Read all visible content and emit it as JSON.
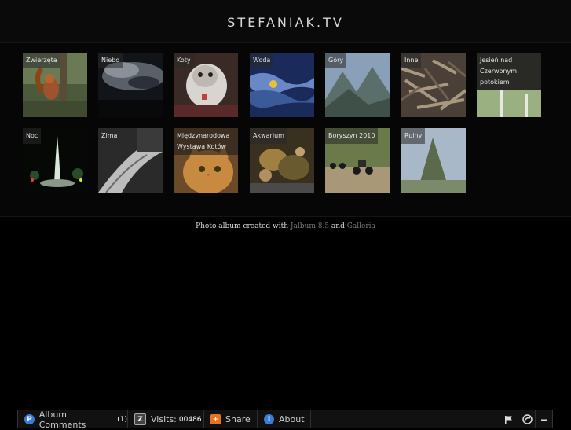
{
  "site": {
    "title": "STEFANIAK.TV"
  },
  "albums": [
    {
      "label": "Zwierzęta",
      "icon": "squirrel-photo"
    },
    {
      "label": "Niebo",
      "icon": "sky-photo"
    },
    {
      "label": "Koty",
      "icon": "cat-photo"
    },
    {
      "label": "Woda",
      "icon": "water-photo"
    },
    {
      "label": "Góry",
      "icon": "mountains-photo"
    },
    {
      "label": "Inne",
      "icon": "debris-photo"
    },
    {
      "label": "Jesień nad Czerwonym potokiem",
      "icon": "autumn-photo"
    },
    {
      "label": "Noc",
      "icon": "fountain-photo"
    },
    {
      "label": "Zima",
      "icon": "winter-photo"
    },
    {
      "label": "Międzynarodowa Wystawa Kotów",
      "icon": "cat-show-photo"
    },
    {
      "label": "Akwarium",
      "icon": "aquarium-photo"
    },
    {
      "label": "Boryszyn 2010",
      "icon": "motorcycles-photo"
    },
    {
      "label": "Ruiny",
      "icon": "ruins-photo"
    }
  ],
  "footer": {
    "prefix": "Photo album created with",
    "link1": "Jalbum 8.5",
    "and": "and",
    "link2": "Galleria"
  },
  "bottom_bar": {
    "comments_label": "Album Comments",
    "comments_count": "(1)",
    "visits_label": "Visits:",
    "visits_count": "00486",
    "share_label": "Share",
    "about_label": "About"
  },
  "colors": {
    "background": "#000000",
    "accent_share": "#e8731e",
    "accent_about": "#3a7bd5",
    "link": "#777777"
  }
}
